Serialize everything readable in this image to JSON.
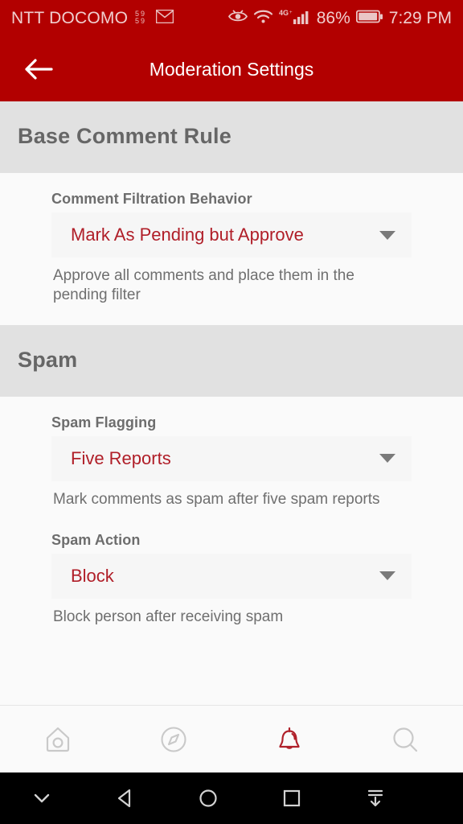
{
  "status_bar": {
    "carrier": "NTT DOCOMO",
    "battery_percent": "86%",
    "time": "7:29 PM",
    "network_type": "4G",
    "icons": [
      "sim-icon",
      "mail-icon",
      "eye-icon",
      "wifi-icon",
      "signal-icon",
      "battery-icon"
    ]
  },
  "app_bar": {
    "title": "Moderation Settings",
    "back_label": "Back"
  },
  "colors": {
    "brand_red": "#b20000",
    "value_red": "#b01e28",
    "section_gray": "#e1e1e1",
    "label_gray": "#6d6d6d",
    "helper_gray": "#6f6f6f"
  },
  "sections": [
    {
      "title": "Base Comment Rule",
      "fields": [
        {
          "label": "Comment Filtration Behavior",
          "value": "Mark As Pending but Approve",
          "helper": "Approve all comments and place them in the pending filter"
        }
      ]
    },
    {
      "title": "Spam",
      "fields": [
        {
          "label": "Spam Flagging",
          "value": "Five Reports",
          "helper": "Mark comments as spam after five spam reports"
        },
        {
          "label": "Spam Action",
          "value": "Block",
          "helper": "Block person after receiving spam"
        }
      ]
    }
  ],
  "tab_bar": {
    "items": [
      {
        "name": "home-icon",
        "label": "Home",
        "active": false
      },
      {
        "name": "compass-icon",
        "label": "Explore",
        "active": false
      },
      {
        "name": "bell-icon",
        "label": "Notifications",
        "active": true
      },
      {
        "name": "search-icon",
        "label": "Search",
        "active": false
      }
    ]
  },
  "android_nav": {
    "items": [
      {
        "name": "chevron-down-icon",
        "label": "Hide"
      },
      {
        "name": "back-triangle-icon",
        "label": "Back"
      },
      {
        "name": "home-circle-icon",
        "label": "Home"
      },
      {
        "name": "recents-square-icon",
        "label": "Recents"
      },
      {
        "name": "hide-keyboard-icon",
        "label": "Hide Keyboard"
      }
    ]
  }
}
